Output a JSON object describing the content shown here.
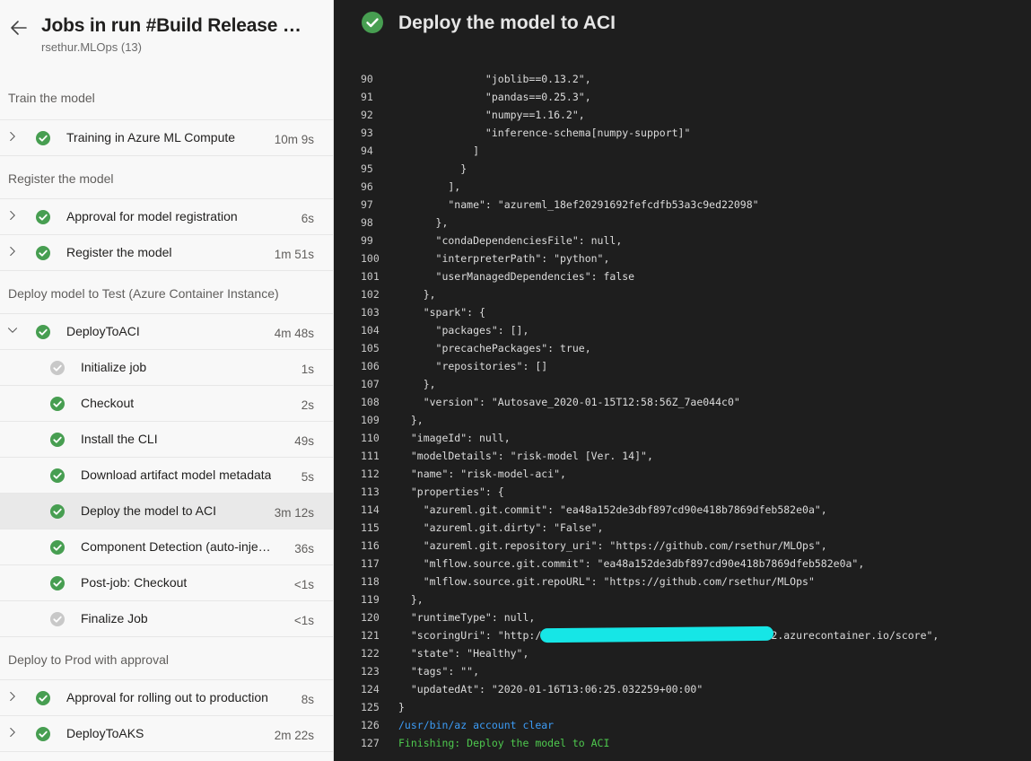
{
  "header": {
    "title": "Jobs in run #Build Release Pipeline",
    "subtitle": "rsethur.MLOps (13)"
  },
  "stages": [
    {
      "title": "Train the model",
      "rows": [
        {
          "label": "Training in Azure ML Compute",
          "duration": "10m 9s",
          "status": "success",
          "level": "job",
          "expanded": false
        }
      ]
    },
    {
      "title": "Register the model",
      "rows": [
        {
          "label": "Approval for model registration",
          "duration": "6s",
          "status": "success",
          "level": "job",
          "expanded": false
        },
        {
          "label": "Register the model",
          "duration": "1m 51s",
          "status": "success",
          "level": "job",
          "expanded": false
        }
      ]
    },
    {
      "title": "Deploy model to Test (Azure Container Instance)",
      "rows": [
        {
          "label": "DeployToACI",
          "duration": "4m 48s",
          "status": "success",
          "level": "job",
          "expanded": true
        },
        {
          "label": "Initialize job",
          "duration": "1s",
          "status": "skipped",
          "level": "task"
        },
        {
          "label": "Checkout",
          "duration": "2s",
          "status": "success",
          "level": "task"
        },
        {
          "label": "Install the CLI",
          "duration": "49s",
          "status": "success",
          "level": "task"
        },
        {
          "label": "Download artifact model metadata",
          "duration": "5s",
          "status": "success",
          "level": "task"
        },
        {
          "label": "Deploy the model to ACI",
          "duration": "3m 12s",
          "status": "success",
          "level": "task",
          "selected": true
        },
        {
          "label": "Component Detection (auto-injected by policy)",
          "duration": "36s",
          "status": "success",
          "level": "task"
        },
        {
          "label": "Post-job: Checkout",
          "duration": "<1s",
          "status": "success",
          "level": "task"
        },
        {
          "label": "Finalize Job",
          "duration": "<1s",
          "status": "skipped",
          "level": "task"
        }
      ]
    },
    {
      "title": "Deploy to Prod with approval",
      "rows": [
        {
          "label": "Approval for rolling out to production",
          "duration": "8s",
          "status": "success",
          "level": "job",
          "expanded": false
        },
        {
          "label": "DeployToAKS",
          "duration": "2m 22s",
          "status": "success",
          "level": "job",
          "expanded": false
        }
      ]
    }
  ],
  "log": {
    "title": "Deploy the model to ACI",
    "lines": [
      {
        "n": "90",
        "t": "              \"joblib==0.13.2\","
      },
      {
        "n": "91",
        "t": "              \"pandas==0.25.3\","
      },
      {
        "n": "92",
        "t": "              \"numpy==1.16.2\","
      },
      {
        "n": "93",
        "t": "              \"inference-schema[numpy-support]\""
      },
      {
        "n": "94",
        "t": "            ]"
      },
      {
        "n": "95",
        "t": "          }"
      },
      {
        "n": "96",
        "t": "        ],"
      },
      {
        "n": "97",
        "t": "        \"name\": \"azureml_18ef20291692fefcdfb53a3c9ed22098\""
      },
      {
        "n": "98",
        "t": "      },"
      },
      {
        "n": "99",
        "t": "      \"condaDependenciesFile\": null,"
      },
      {
        "n": "100",
        "t": "      \"interpreterPath\": \"python\","
      },
      {
        "n": "101",
        "t": "      \"userManagedDependencies\": false"
      },
      {
        "n": "102",
        "t": "    },"
      },
      {
        "n": "103",
        "t": "    \"spark\": {"
      },
      {
        "n": "104",
        "t": "      \"packages\": [],"
      },
      {
        "n": "105",
        "t": "      \"precachePackages\": true,"
      },
      {
        "n": "106",
        "t": "      \"repositories\": []"
      },
      {
        "n": "107",
        "t": "    },"
      },
      {
        "n": "108",
        "t": "    \"version\": \"Autosave_2020-01-15T12:58:56Z_7ae044c0\""
      },
      {
        "n": "109",
        "t": "  },"
      },
      {
        "n": "110",
        "t": "  \"imageId\": null,"
      },
      {
        "n": "111",
        "t": "  \"modelDetails\": \"risk-model [Ver. 14]\","
      },
      {
        "n": "112",
        "t": "  \"name\": \"risk-model-aci\","
      },
      {
        "n": "113",
        "t": "  \"properties\": {"
      },
      {
        "n": "114",
        "t": "    \"azureml.git.commit\": \"ea48a152de3dbf897cd90e418b7869dfeb582e0a\","
      },
      {
        "n": "115",
        "t": "    \"azureml.git.dirty\": \"False\","
      },
      {
        "n": "116",
        "t": "    \"azureml.git.repository_uri\": \"https://github.com/rsethur/MLOps\","
      },
      {
        "n": "117",
        "t": "    \"mlflow.source.git.commit\": \"ea48a152de3dbf897cd90e418b7869dfeb582e0a\","
      },
      {
        "n": "118",
        "t": "    \"mlflow.source.git.repoURL\": \"https://github.com/rsethur/MLOps\""
      },
      {
        "n": "119",
        "t": "  },"
      },
      {
        "n": "120",
        "t": "  \"runtimeType\": null,"
      },
      {
        "n": "121",
        "t": "  \"scoringUri\": \"http://                                   s2.azurecontainer.io/score\","
      },
      {
        "n": "122",
        "t": "  \"state\": \"Healthy\","
      },
      {
        "n": "123",
        "t": "  \"tags\": \"\","
      },
      {
        "n": "124",
        "t": "  \"updatedAt\": \"2020-01-16T13:06:25.032259+00:00\""
      },
      {
        "n": "125",
        "t": "}"
      },
      {
        "n": "126",
        "t": "/usr/bin/az account clear",
        "kind": "cmd"
      },
      {
        "n": "127",
        "t": "Finishing: Deploy the model to ACI",
        "kind": "ok"
      }
    ]
  },
  "colors": {
    "success": "#479e51",
    "skipped": "#c8c8c8",
    "log_bg": "#1e1e1e",
    "panel_bg": "#f8f8f8",
    "command": "#3c9cf6",
    "finish": "#4ec94e"
  },
  "icons": {
    "back": "arrow-left-icon",
    "success": "check-circle-icon",
    "skipped": "skipped-circle-icon",
    "expand": "chevron-right-icon",
    "collapse": "chevron-down-icon"
  }
}
